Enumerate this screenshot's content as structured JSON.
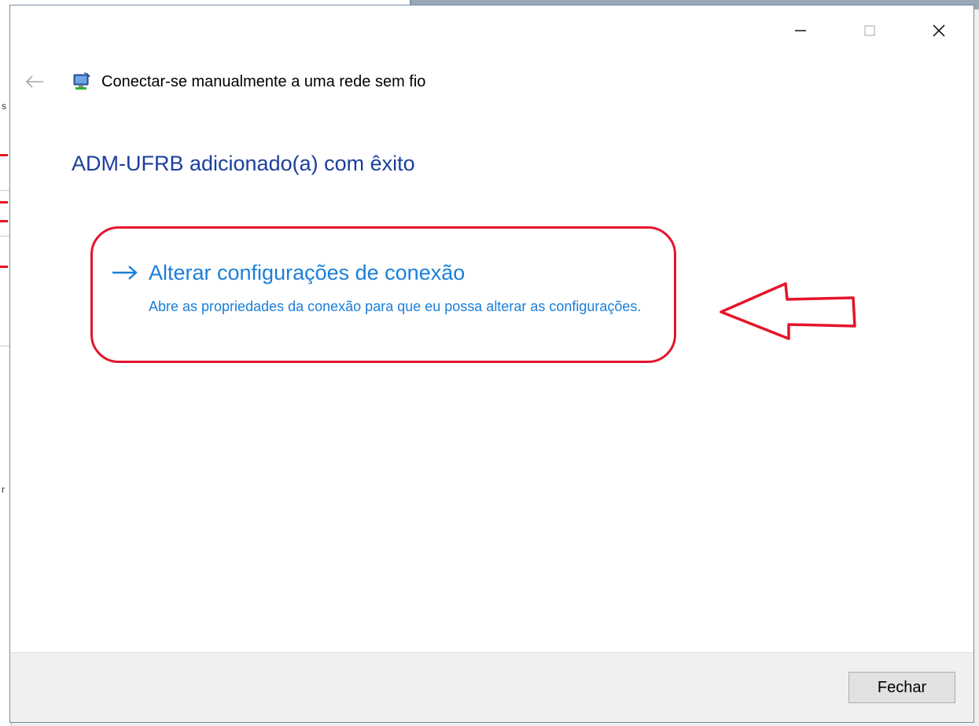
{
  "window": {
    "title": "Conectar-se manualmente a uma rede sem fio",
    "controls": {
      "minimize_icon": "minimize-icon",
      "maximize_icon": "maximize-icon",
      "close_icon": "close-icon"
    }
  },
  "nav": {
    "back_icon": "back-arrow-icon"
  },
  "app_icon": "wifi-network-icon",
  "main": {
    "heading": "ADM-UFRB adicionado(a) com êxito",
    "link": {
      "icon": "arrow-right-icon",
      "title": "Alterar configurações de conexão",
      "description": "Abre as propriedades da conexão para que eu possa alterar as configurações."
    }
  },
  "footer": {
    "close_button": "Fechar"
  },
  "colors": {
    "heading": "#1b3f9c",
    "link": "#1a7fd9",
    "annotation": "#e5142b"
  }
}
